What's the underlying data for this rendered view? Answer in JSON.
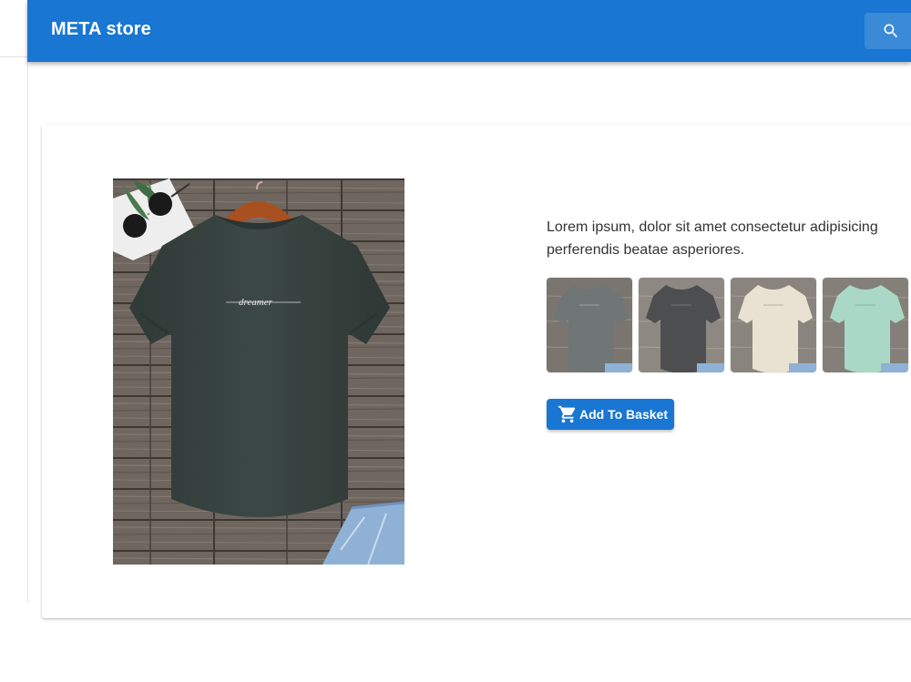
{
  "app": {
    "title": "META store"
  },
  "header": {
    "search_icon": "search-icon"
  },
  "product": {
    "description": "Lorem ipsum, dolor sit amet consectetur adipisicing\nperferendis beatae asperiores.",
    "main_image": "dark green t-shirt with \"dreamer\" print on wooden background",
    "thumbnails": [
      {
        "shirt_color": "#6f7675"
      },
      {
        "shirt_color": "#4d4e50"
      },
      {
        "shirt_color": "#e9e2d2"
      },
      {
        "shirt_color": "#a9d9c6"
      }
    ],
    "add_to_basket_label": "Add To Basket",
    "cart_icon": "cart-icon"
  },
  "colors": {
    "primary": "#1976d2",
    "main_shirt": "#3a4643",
    "wood": "#6a625b"
  }
}
